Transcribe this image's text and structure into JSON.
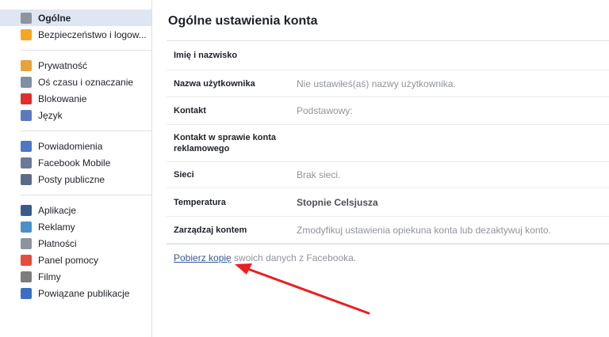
{
  "sidebar": {
    "groups": [
      {
        "items": [
          {
            "label": "Ogólne",
            "icon": "gears-icon",
            "color": "#8d949e",
            "active": true
          },
          {
            "label": "Bezpieczeństwo i logow...",
            "icon": "shield-icon",
            "color": "#f5a623"
          }
        ]
      },
      {
        "items": [
          {
            "label": "Prywatność",
            "icon": "lock-icon",
            "color": "#e8a23b"
          },
          {
            "label": "Oś czasu i oznaczanie",
            "icon": "timeline-icon",
            "color": "#7f8fa6"
          },
          {
            "label": "Blokowanie",
            "icon": "block-icon",
            "color": "#e02f2f"
          },
          {
            "label": "Język",
            "icon": "language-icon",
            "color": "#5b7bbd"
          }
        ]
      },
      {
        "items": [
          {
            "label": "Powiadomienia",
            "icon": "globe-icon",
            "color": "#4a78c7"
          },
          {
            "label": "Facebook Mobile",
            "icon": "phone-icon",
            "color": "#6b7a99"
          },
          {
            "label": "Posty publiczne",
            "icon": "rss-icon",
            "color": "#5b6a8a"
          }
        ]
      },
      {
        "items": [
          {
            "label": "Aplikacje",
            "icon": "apps-icon",
            "color": "#3b5a8c"
          },
          {
            "label": "Reklamy",
            "icon": "ads-icon",
            "color": "#4a90c9"
          },
          {
            "label": "Płatności",
            "icon": "card-icon",
            "color": "#8d949e"
          },
          {
            "label": "Panel pomocy",
            "icon": "lifebuoy-icon",
            "color": "#e84c3d"
          },
          {
            "label": "Filmy",
            "icon": "film-icon",
            "color": "#7d7d7d"
          },
          {
            "label": "Powiązane publikacje",
            "icon": "publications-icon",
            "color": "#3b6fc2"
          }
        ]
      }
    ]
  },
  "main": {
    "title": "Ogólne ustawienia konta",
    "rows": [
      {
        "name": "Imię i nazwisko",
        "value": "",
        "style": "muted",
        "height": 36
      },
      {
        "name": "Nazwa użytkownika",
        "value": "Nie ustawiłeś(aś) nazwy użytkownika.",
        "style": "muted",
        "height": 33
      },
      {
        "name": "Kontakt",
        "value": "Podstawowy:",
        "style": "muted",
        "height": 34
      },
      {
        "name": "Kontakt w sprawie konta reklamowego",
        "value": "",
        "style": "muted",
        "height": 46
      },
      {
        "name": "Sieci",
        "value": "Brak sieci.",
        "style": "muted",
        "height": 32
      },
      {
        "name": "Temperatura",
        "value": "Stopnie Celsjusza",
        "style": "dark",
        "height": 35
      },
      {
        "name": "Zarządzaj kontem",
        "value": "Zmodyfikuj ustawienia opiekuna konta lub dezaktywuj konto.",
        "style": "muted",
        "height": 33
      }
    ],
    "footer": {
      "link": "Pobierz kopię",
      "text": " swoich danych z Facebooka."
    }
  },
  "colors": {
    "accent": "#365899",
    "arrow": "#e8201d",
    "active_bg": "#dfe6f3"
  }
}
